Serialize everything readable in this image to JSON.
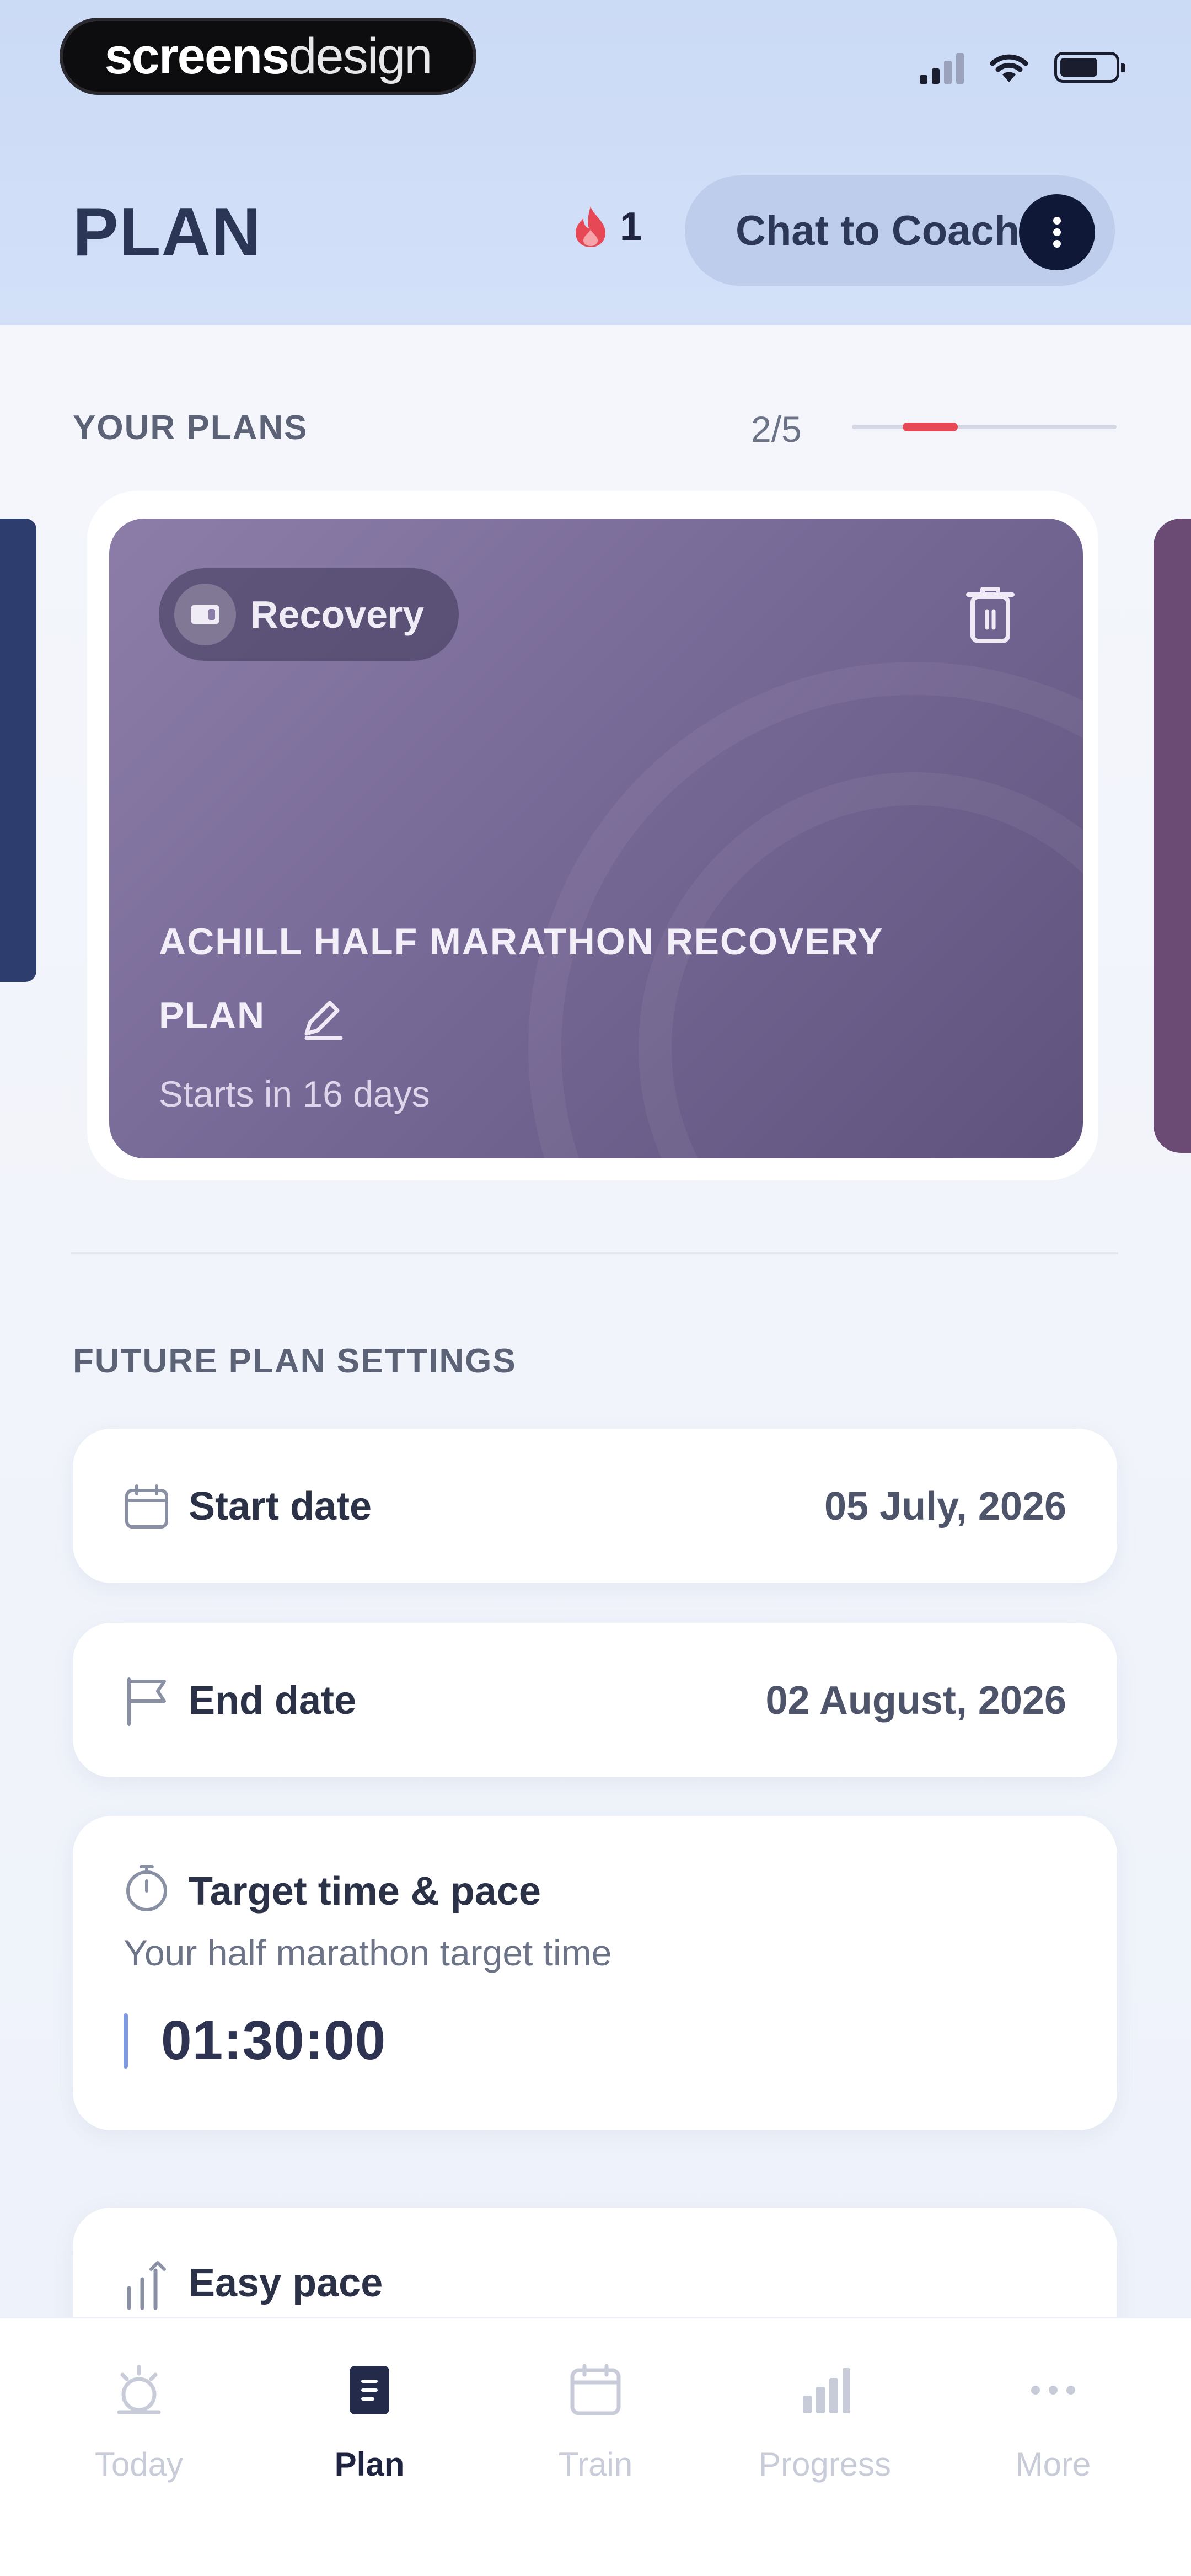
{
  "status_bar": {
    "brand_bold": "screens",
    "brand_light": "design"
  },
  "header": {
    "title": "PLAN",
    "streak_count": "1",
    "coach_button_label": "Chat to Coach"
  },
  "plans": {
    "section_label": "YOUR PLANS",
    "pager_text": "2/5",
    "pager_progress": 0.4,
    "card": {
      "tag_label": "Recovery",
      "title_line1": "ACHILL HALF MARATHON RECOVERY",
      "title_line2": "PLAN",
      "subtitle": "Starts in 16 days"
    }
  },
  "settings": {
    "section_label": "FUTURE PLAN SETTINGS",
    "start_date": {
      "label": "Start date",
      "value": "05 July, 2026"
    },
    "end_date": {
      "label": "End date",
      "value": "02 August, 2026"
    },
    "target": {
      "label": "Target time & pace",
      "subtitle": "Your half marathon target time",
      "value": "01:30:00"
    },
    "easy_pace": {
      "label": "Easy pace"
    }
  },
  "tabbar": {
    "items": [
      {
        "label": "Today",
        "icon": "today-icon",
        "active": false
      },
      {
        "label": "Plan",
        "icon": "plan-icon",
        "active": true
      },
      {
        "label": "Train",
        "icon": "calendar-icon",
        "active": false
      },
      {
        "label": "Progress",
        "icon": "chart-icon",
        "active": false
      },
      {
        "label": "More",
        "icon": "more-icon",
        "active": false
      }
    ]
  },
  "colors": {
    "accent_red": "#e74856",
    "card_purple": "#786a97",
    "navy": "#0f1836"
  }
}
